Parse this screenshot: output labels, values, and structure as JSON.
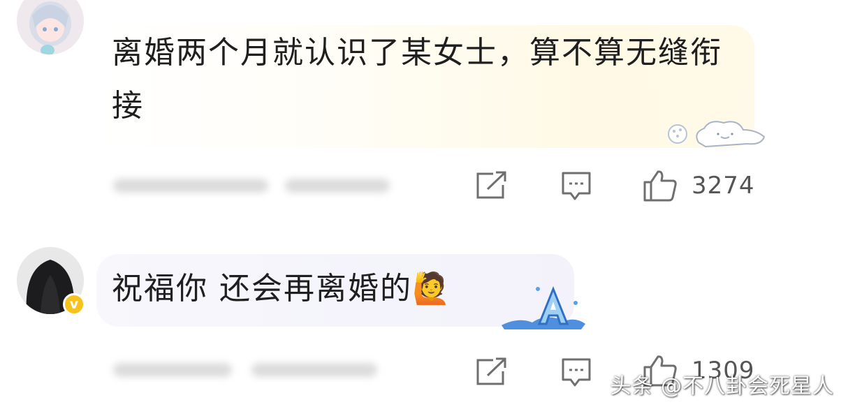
{
  "comments": [
    {
      "text": "离婚两个月就认识了某女士，算不算无缝衔接",
      "likes": "3274",
      "avatar_icon": "anime-girl-avatar",
      "sticker_icon": "cinnamoroll-sticker"
    },
    {
      "text": "祝福你 还会再离婚的🙋",
      "likes": "1309",
      "avatar_icon": "dark-hair-avatar",
      "verified_badge": "v",
      "sticker_icon": "ice-letter-a-sticker"
    }
  ],
  "watermark": "头条 @不八卦会死星人",
  "colors": {
    "badge": "#f6c21b",
    "icon": "#6f6f6f",
    "bubble1": "#fff9e5",
    "bubble2": "#f3f2fb"
  }
}
